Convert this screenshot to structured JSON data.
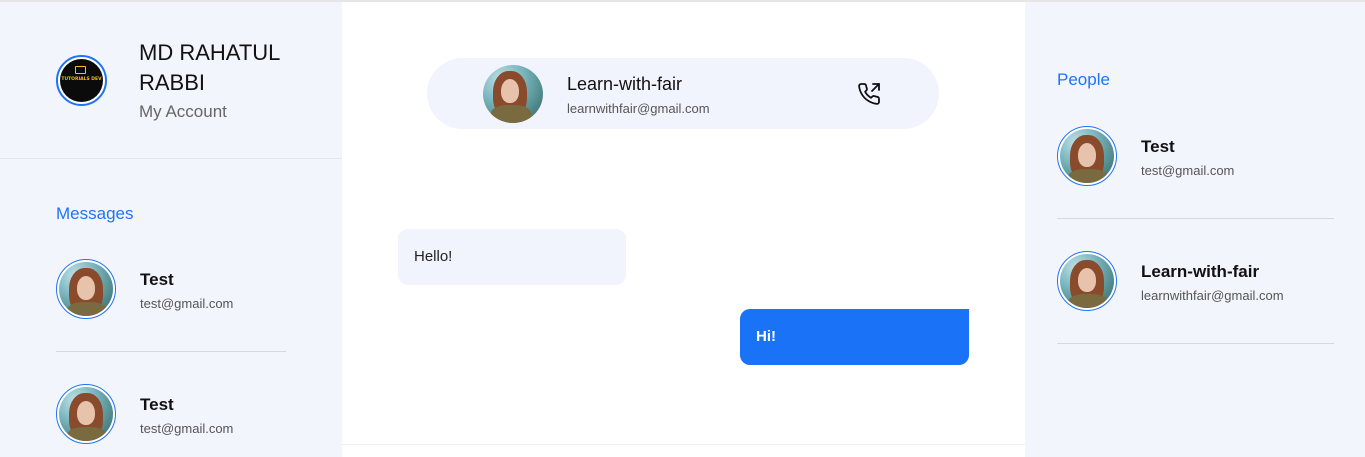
{
  "account": {
    "name": "MD RAHATUL RABBI",
    "subtitle": "My Account",
    "logo_text": "TUTORIALS DEV"
  },
  "messages": {
    "title": "Messages",
    "items": [
      {
        "name": "Test",
        "email": "test@gmail.com"
      },
      {
        "name": "Test",
        "email": "test@gmail.com"
      }
    ]
  },
  "chat": {
    "header": {
      "name": "Learn-with-fair",
      "email": "learnwithfair@gmail.com",
      "call_icon": "phone-outgoing-icon"
    },
    "messages": [
      {
        "direction": "incoming",
        "text": "Hello!"
      },
      {
        "direction": "outgoing",
        "text": "Hi!"
      }
    ]
  },
  "people": {
    "title": "People",
    "items": [
      {
        "name": "Test",
        "email": "test@gmail.com"
      },
      {
        "name": "Learn-with-fair",
        "email": "learnwithfair@gmail.com"
      }
    ]
  },
  "colors": {
    "accent": "#1e74f5",
    "sidebar_bg": "#f3f5fd",
    "bubble_out": "#1a73f7",
    "bubble_in": "#f1f4fd"
  }
}
